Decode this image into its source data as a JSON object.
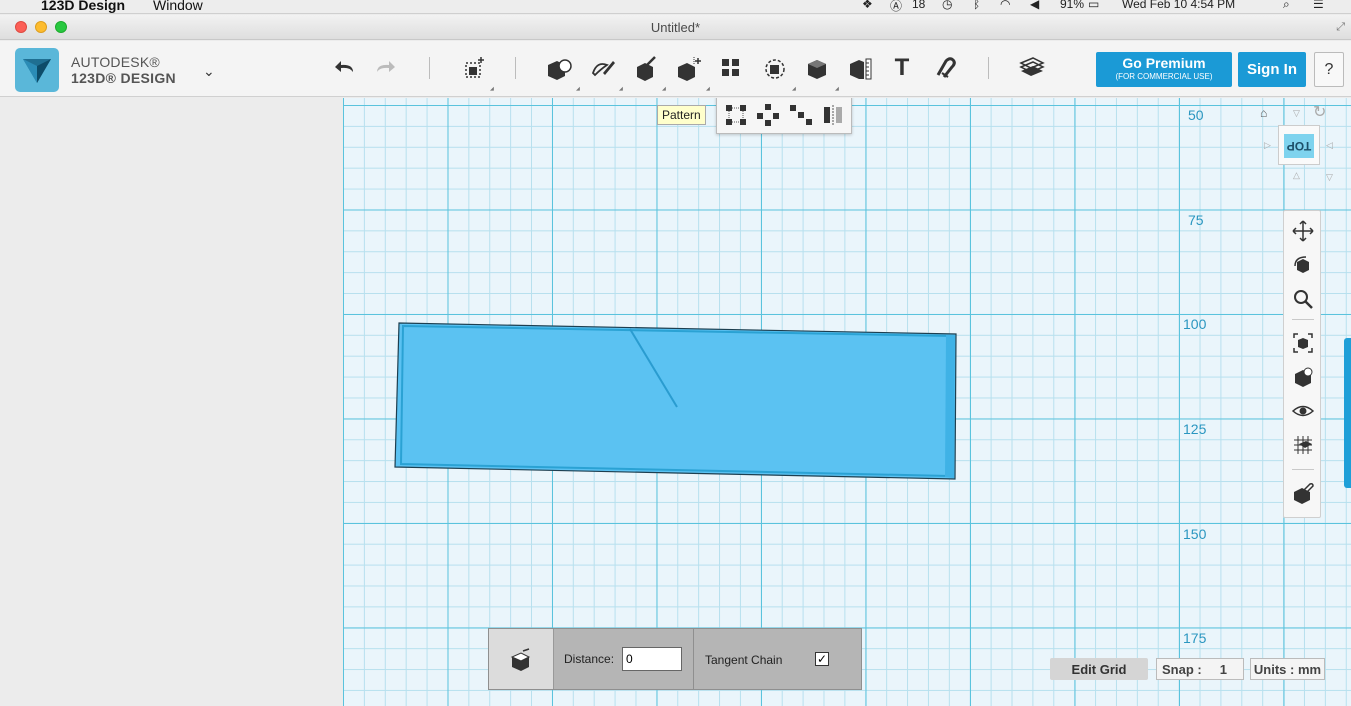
{
  "menubar": {
    "app_name": "123D Design",
    "menu_window": "Window",
    "notification_count": "18",
    "battery": "91%",
    "datetime": "Wed Feb 10  4:54 PM"
  },
  "window": {
    "title": "Untitled*"
  },
  "brand": {
    "line1": "AUTODESK®",
    "line2": "123D® DESIGN"
  },
  "toolbar": {
    "tooltip": "Pattern",
    "text_tool_glyph": "T"
  },
  "account": {
    "go_premium": "Go Premium",
    "go_premium_sub": "(FOR COMMERCIAL USE)",
    "sign_in": "Sign In",
    "help": "?"
  },
  "viewcube": {
    "face_label": "TOP"
  },
  "ruler": {
    "labels": [
      "50",
      "75",
      "100",
      "125",
      "150",
      "175"
    ]
  },
  "operation": {
    "distance_label": "Distance:",
    "distance_value": "0",
    "tangent_chain_label": "Tangent Chain",
    "tangent_chain_checked": "✓"
  },
  "statusbar": {
    "edit_grid": "Edit Grid",
    "snap": "Snap :     1",
    "units": "Units : mm"
  },
  "colors": {
    "accent": "#1b9ad6",
    "shape_fill": "#5bc2f2",
    "grid_major": "#5ac3dd"
  }
}
